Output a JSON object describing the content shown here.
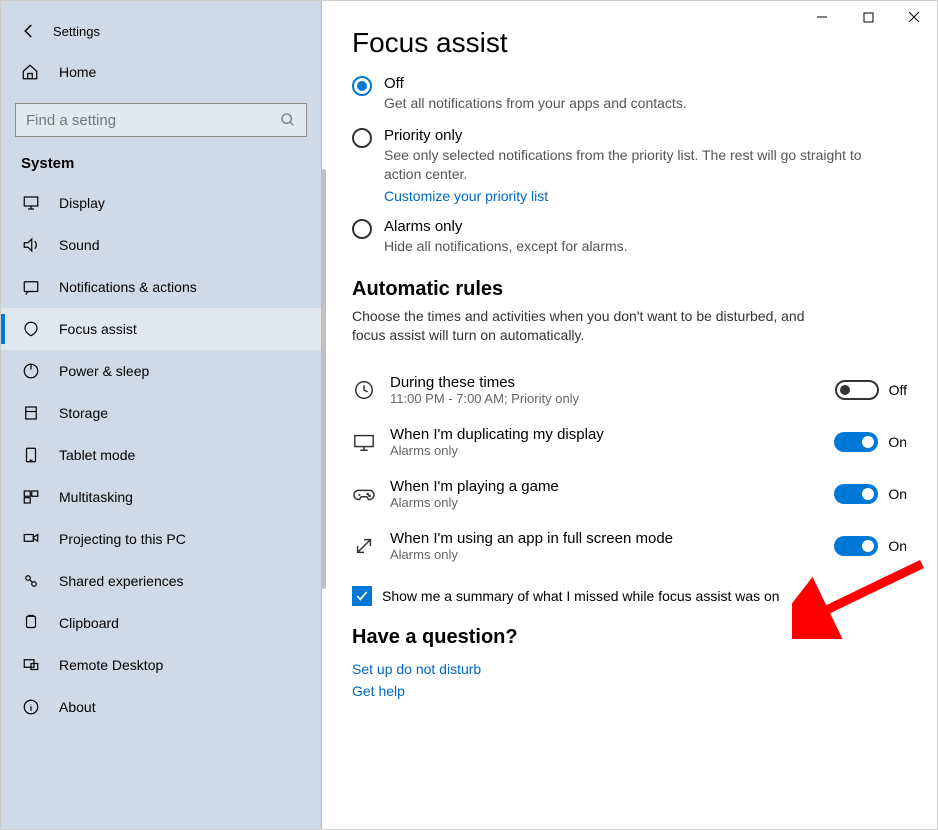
{
  "window": {
    "title": "Settings"
  },
  "sidebar": {
    "home_label": "Home",
    "search_placeholder": "Find a setting",
    "section_label": "System",
    "items": [
      {
        "label": "Display"
      },
      {
        "label": "Sound"
      },
      {
        "label": "Notifications & actions"
      },
      {
        "label": "Focus assist"
      },
      {
        "label": "Power & sleep"
      },
      {
        "label": "Storage"
      },
      {
        "label": "Tablet mode"
      },
      {
        "label": "Multitasking"
      },
      {
        "label": "Projecting to this PC"
      },
      {
        "label": "Shared experiences"
      },
      {
        "label": "Clipboard"
      },
      {
        "label": "Remote Desktop"
      },
      {
        "label": "About"
      }
    ],
    "active_index": 3
  },
  "main": {
    "title": "Focus assist",
    "radios": {
      "selected": 0,
      "options": [
        {
          "title": "Off",
          "desc": "Get all notifications from your apps and contacts."
        },
        {
          "title": "Priority only",
          "desc": "See only selected notifications from the priority list. The rest will go straight to action center.",
          "link": "Customize your priority list"
        },
        {
          "title": "Alarms only",
          "desc": "Hide all notifications, except for alarms."
        }
      ]
    },
    "auto_rules": {
      "heading": "Automatic rules",
      "desc": "Choose the times and activities when you don't want to be disturbed, and focus assist will turn on automatically.",
      "rules": [
        {
          "title": "During these times",
          "sub": "11:00 PM - 7:00 AM; Priority only",
          "state": false,
          "state_label": "Off"
        },
        {
          "title": "When I'm duplicating my display",
          "sub": "Alarms only",
          "state": true,
          "state_label": "On"
        },
        {
          "title": "When I'm playing a game",
          "sub": "Alarms only",
          "state": true,
          "state_label": "On"
        },
        {
          "title": "When I'm using an app in full screen mode",
          "sub": "Alarms only",
          "state": true,
          "state_label": "On"
        }
      ]
    },
    "summary_checkbox": {
      "checked": true,
      "label": "Show me a summary of what I missed while focus assist was on"
    },
    "question": {
      "heading": "Have a question?",
      "links": [
        "Set up do not disturb",
        "Get help"
      ]
    }
  }
}
